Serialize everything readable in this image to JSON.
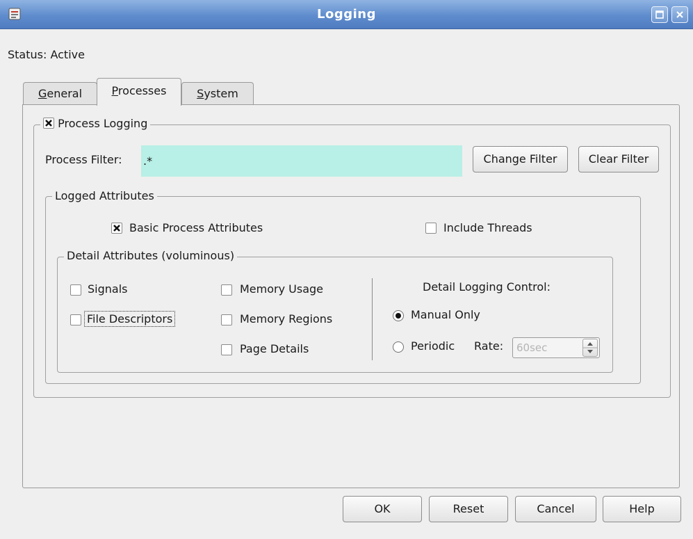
{
  "window": {
    "title": "Logging",
    "app_icon": "app-icon",
    "controls": [
      "maximize-icon",
      "close-icon"
    ]
  },
  "status": "Status: Active",
  "tabs": [
    {
      "label": "General",
      "mnemonic": "G",
      "rest": "eneral",
      "active": false
    },
    {
      "label": "Processes",
      "mnemonic": "P",
      "rest": "rocesses",
      "active": true
    },
    {
      "label": "System",
      "mnemonic": "S",
      "rest": "ystem",
      "active": false
    }
  ],
  "process_logging": {
    "label": "Process Logging",
    "checked": true,
    "filter_label": "Process Filter:",
    "filter_value": ".*",
    "filter_bg": "#b8efe6",
    "change_filter": "Change Filter",
    "clear_filter": "Clear Filter"
  },
  "logged_attributes": {
    "legend": "Logged Attributes",
    "basic": {
      "label": "Basic Process Attributes",
      "checked": true
    },
    "threads": {
      "label": "Include Threads",
      "checked": false
    }
  },
  "detail_attributes": {
    "legend": "Detail Attributes (voluminous)",
    "signals": {
      "label": "Signals",
      "checked": false
    },
    "file_descriptors": {
      "label": "File Descriptors",
      "checked": false
    },
    "memory_usage": {
      "label": "Memory Usage",
      "checked": false
    },
    "memory_regions": {
      "label": "Memory Regions",
      "checked": false
    },
    "page_details": {
      "label": "Page Details",
      "checked": false
    }
  },
  "detail_control": {
    "title": "Detail Logging Control:",
    "manual_only": {
      "label": "Manual Only",
      "selected": true
    },
    "periodic": {
      "label": "Periodic",
      "selected": false
    },
    "rate_label": "Rate:",
    "rate_value": "60sec"
  },
  "buttons": {
    "ok": "OK",
    "reset": "Reset",
    "cancel": "Cancel",
    "help": "Help"
  }
}
